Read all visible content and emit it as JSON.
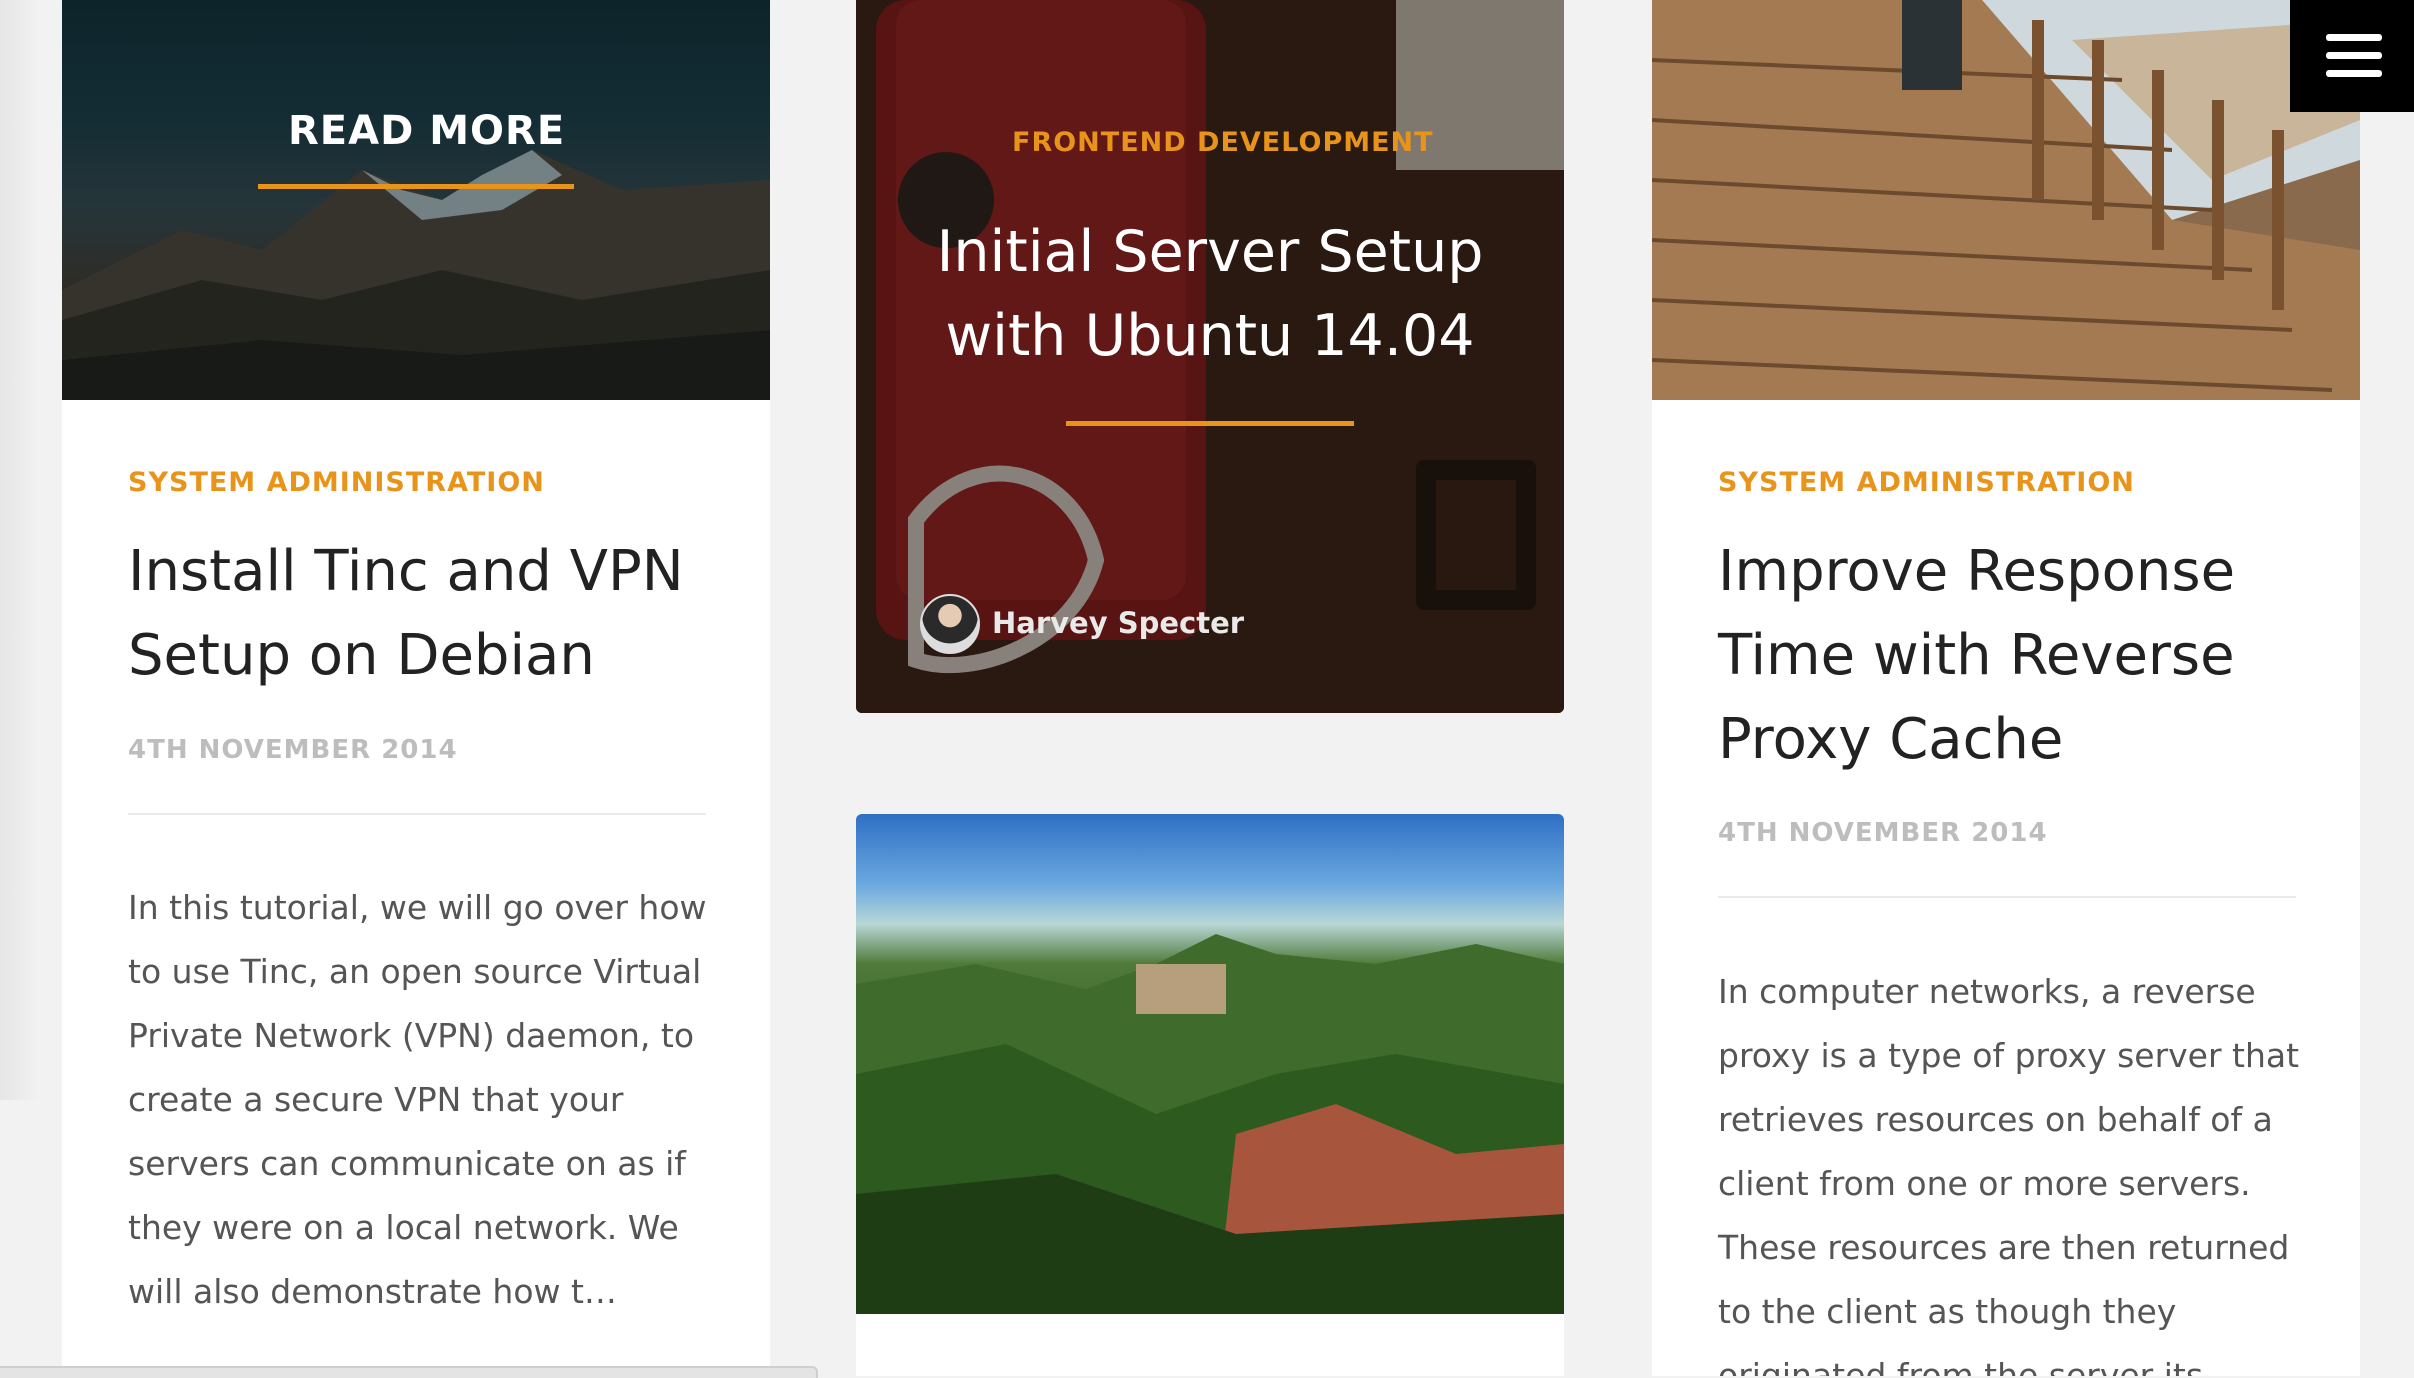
{
  "menu": {
    "icon": "hamburger-menu-icon"
  },
  "posts": {
    "left": {
      "overlay_label": "READ MORE",
      "category": "SYSTEM ADMINISTRATION",
      "title": "Install Tinc and VPN Setup on Debian",
      "date": "4TH NOVEMBER 2014",
      "excerpt": "In this tutorial, we will go over how to use Tinc, an open source Virtual Private Network (VPN) daemon, to create a secure VPN that your servers can communicate on as if they were on a local network. We will also demonstrate how t…"
    },
    "featured": {
      "category": "FRONTEND DEVELOPMENT",
      "title": "Initial Server Setup with Ubuntu 14.04",
      "author": "Harvey Specter"
    },
    "right": {
      "category": "SYSTEM ADMINISTRATION",
      "title": "Improve Response Time with Reverse Proxy Cache",
      "date": "4TH NOVEMBER 2014",
      "excerpt": "In computer networks, a reverse proxy is a type of proxy server that retrieves resources on behalf of a client from one or more servers. These resources are then returned to the client as though they originated from the server its…"
    }
  },
  "colors": {
    "accent": "#e8931a",
    "title": "#222222",
    "date": "#bdbdbd",
    "text": "#555555"
  }
}
